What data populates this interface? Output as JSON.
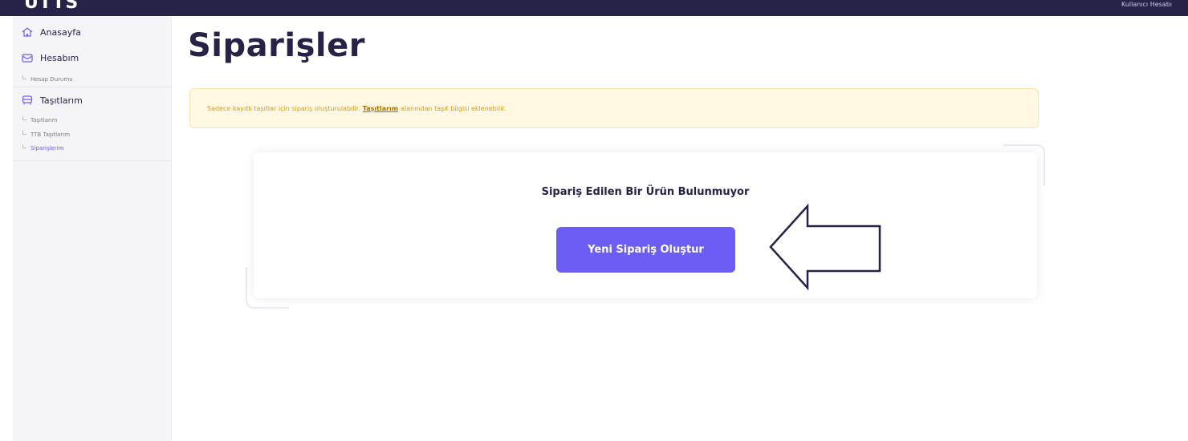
{
  "header": {
    "logo": "UTTS",
    "user_text": "Kullanıcı Hesabı"
  },
  "sidebar": {
    "items": [
      {
        "label": "Anasayfa",
        "icon": "home-icon"
      },
      {
        "label": "Hesabım",
        "icon": "envelope-icon"
      },
      {
        "label": "Taşıtlarım",
        "icon": "car-icon"
      }
    ],
    "subitems": {
      "hesap_durumu": "Hesap Durumu",
      "tasitlarim": "Taşıtlarım",
      "ttb_tasitlarim": "TTB Taşıtlarım",
      "siparislerim": "Siparişlerim"
    }
  },
  "main": {
    "title": "Siparişler",
    "alert": {
      "prefix": "Sadece kayıtlı taşıtlar için sipariş oluşturulabilir.",
      "link": "Taşıtlarım",
      "suffix": "alanından taşıt bilgisi eklenebilir."
    },
    "empty_message": "Sipariş Edilen Bir Ürün Bulunmuyor",
    "cta_label": "Yeni Sipariş Oluştur"
  },
  "colors": {
    "brand_dark": "#262248",
    "accent": "#6c5ef5",
    "warning_bg": "#fff8e2",
    "warning_text": "#d49a18"
  }
}
